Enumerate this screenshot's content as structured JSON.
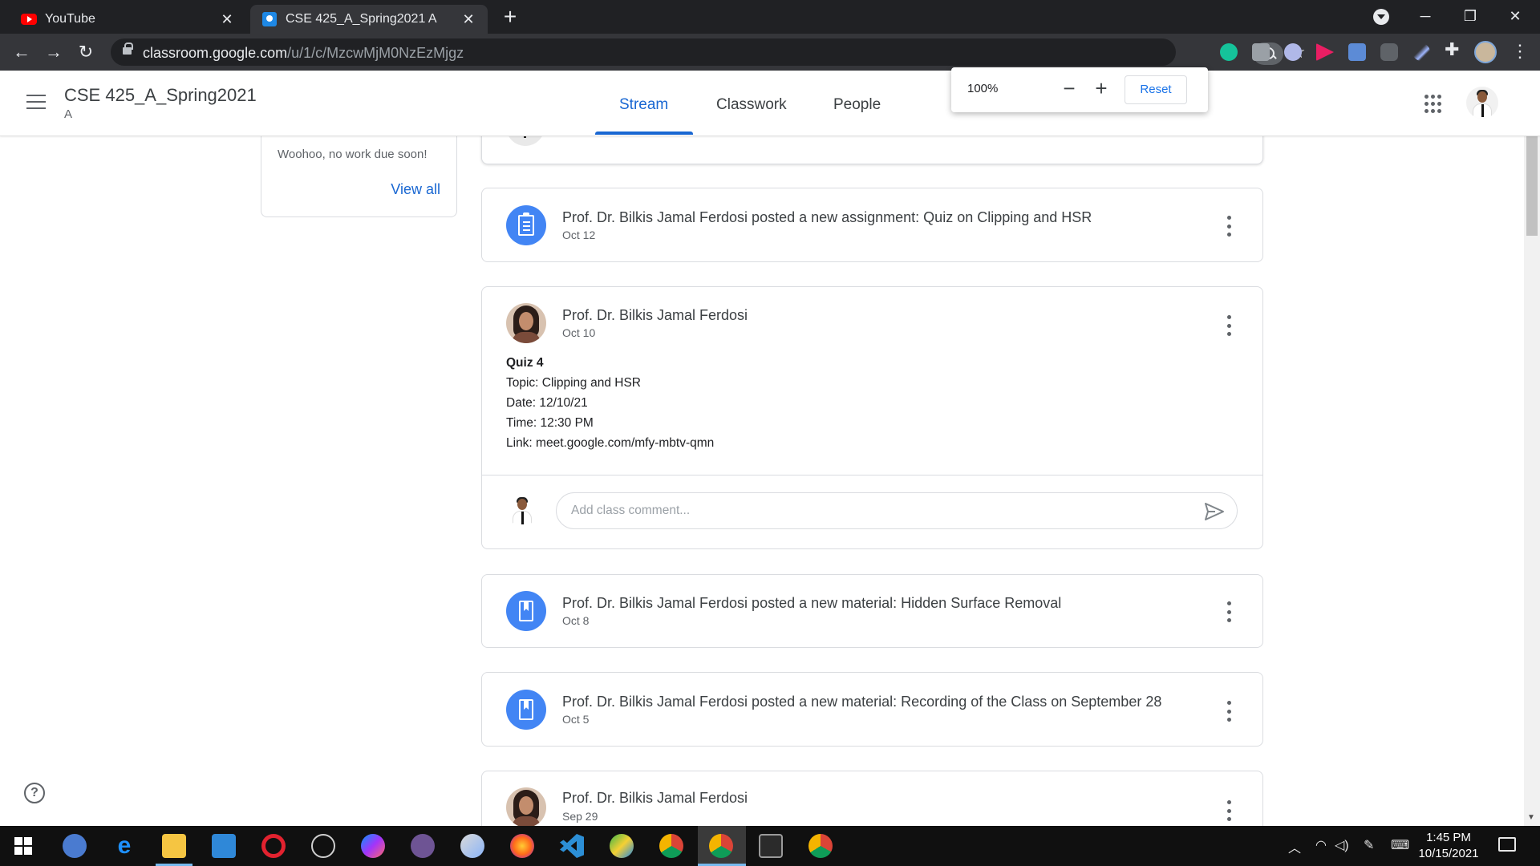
{
  "browser": {
    "tabs": [
      {
        "title": "YouTube",
        "icon": "youtube-icon"
      },
      {
        "title": "CSE 425_A_Spring2021 A",
        "icon": "google-classroom-icon"
      }
    ],
    "url_main": "classroom.google.com",
    "url_path": "/u/1/c/MzcwMjM0NzEzMjgz",
    "zoom_popup": {
      "value": "100%",
      "reset_label": "Reset"
    }
  },
  "header": {
    "class_title": "CSE 425_A_Spring2021",
    "class_section": "A",
    "tabs": [
      {
        "label": "Stream",
        "active": true
      },
      {
        "label": "Classwork",
        "active": false
      },
      {
        "label": "People",
        "active": false
      }
    ]
  },
  "upcoming": {
    "empty_text": "Woohoo, no work due soon!",
    "view_all": "View all"
  },
  "stream": {
    "posts": [
      {
        "title": "Prof. Dr. Bilkis Jamal Ferdosi posted a new assignment: Quiz on Clipping and HSR",
        "date": "Oct 12",
        "icon": "assignment-icon"
      },
      {
        "title": "Prof. Dr. Bilkis Jamal Ferdosi",
        "date": "Oct 10",
        "body": {
          "heading": "Quiz 4",
          "topic": "Topic: Clipping and HSR",
          "date": "Date: 12/10/21",
          "time": "Time: 12:30 PM",
          "link": "Link: meet.google.com/mfy-mbtv-qmn"
        },
        "comment_placeholder": "Add class comment..."
      },
      {
        "title": "Prof. Dr. Bilkis Jamal Ferdosi posted a new material: Hidden Surface Removal",
        "date": "Oct 8",
        "icon": "material-icon"
      },
      {
        "title": "Prof. Dr. Bilkis Jamal Ferdosi posted a new material: Recording of the Class on September 28",
        "date": "Oct 5",
        "icon": "material-icon"
      },
      {
        "title": "Prof. Dr. Bilkis Jamal Ferdosi",
        "date": "Sep 29"
      }
    ]
  },
  "taskbar": {
    "time": "1:45 PM",
    "date": "10/15/2021"
  },
  "colors": {
    "accent": "#1967d2",
    "post_icon": "#4285f4",
    "chrome_dark": "#202124"
  }
}
